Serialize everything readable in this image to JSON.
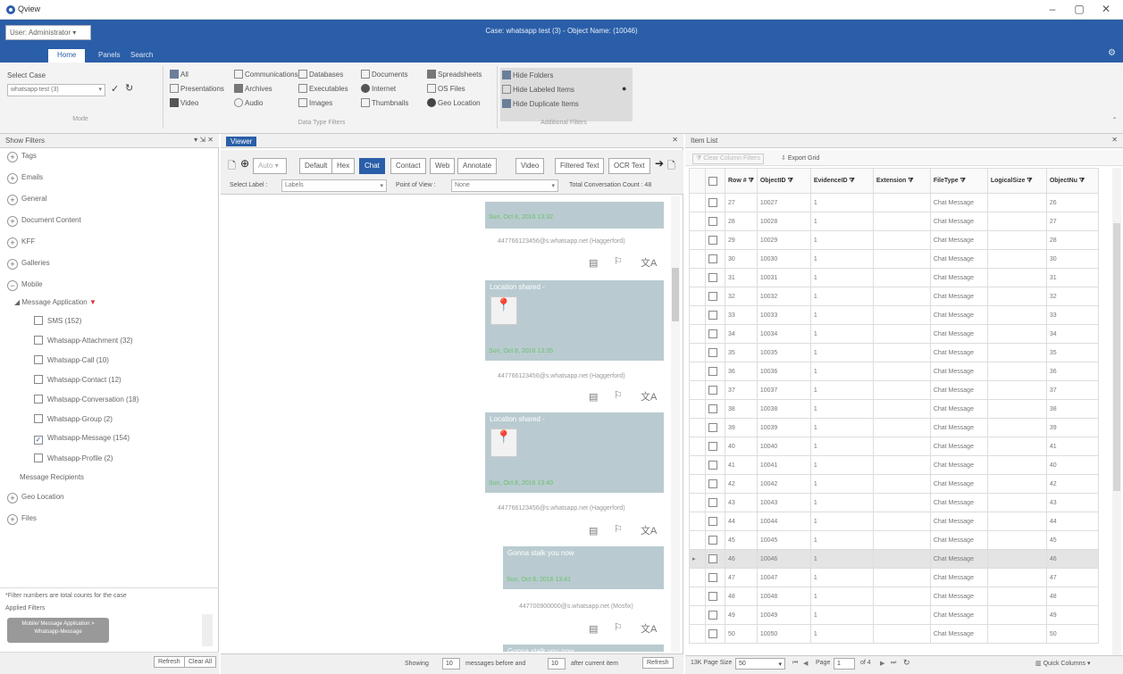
{
  "app": {
    "title": "Qview"
  },
  "window_controls": {
    "minimize": "–",
    "maximize": "▢",
    "close": "✕"
  },
  "header": {
    "user": "User: Administrator ▾",
    "case_title": "Case: whatsapp test (3) - Object Name: (10046)"
  },
  "ribbon_tabs": [
    {
      "label": "Home"
    },
    {
      "label": "Panels"
    },
    {
      "label": "Search"
    }
  ],
  "ribbon": {
    "select_case_label": "Select Case",
    "case_value": "whatsapp test (3)",
    "mode_group": "Mode",
    "data_types": {
      "all": "All",
      "presentations": "Presentations",
      "video": "Video",
      "communications": "Communications",
      "archives": "Archives",
      "audio": "Audio",
      "databases": "Databases",
      "executables": "Executables",
      "images": "Images",
      "documents": "Documents",
      "internet": "Internet",
      "thumbnails": "Thumbnails",
      "spreadsheets": "Spreadsheets",
      "os_files": "OS Files",
      "geo_location": "Geo Location",
      "group_name": "Data Type Filters"
    },
    "additional": {
      "hide_folders": "Hide Folders",
      "hide_labeled": "Hide Labeled Items",
      "hide_duplicate": "Hide Duplicate Items",
      "group_name": "Additional Filters"
    }
  },
  "left_panel": {
    "title": "Show Filters",
    "pin_icons": "▾ ⇲ ✕",
    "filters": [
      {
        "sym": "+",
        "label": "Tags"
      },
      {
        "sym": "+",
        "label": "Emails"
      },
      {
        "sym": "+",
        "label": "General"
      },
      {
        "sym": "+",
        "label": "Document Content"
      },
      {
        "sym": "+",
        "label": "KFF"
      },
      {
        "sym": "+",
        "label": "Galleries"
      },
      {
        "sym": "−",
        "label": "Mobile"
      }
    ],
    "message_app": "Message Application",
    "sub_items": [
      {
        "label": "SMS (152)",
        "checked": false
      },
      {
        "label": "Whatsapp-Attachment (32)",
        "checked": false
      },
      {
        "label": "Whatsapp-Call (10)",
        "checked": false
      },
      {
        "label": "Whatsapp-Contact (12)",
        "checked": false
      },
      {
        "label": "Whatsapp-Conversation (18)",
        "checked": false
      },
      {
        "label": "Whatsapp-Group (2)",
        "checked": false
      },
      {
        "label": "Whatsapp-Message (154)",
        "checked": true
      },
      {
        "label": "Whatsapp-Profile (2)",
        "checked": false
      }
    ],
    "message_recipients": "Message Recipients",
    "geo_location": "Geo Location",
    "files": "Files",
    "note": "*Filter numbers are total counts for the case",
    "applied_filters": "Applied Filters",
    "applied_chip_1": "Mobile/ Message Application >",
    "applied_chip_2": "Whatsapp-Message",
    "refresh": "Refresh",
    "clear_all": "Clear All"
  },
  "viewer": {
    "title": "Viewer",
    "buttons": [
      "Default",
      "Hex",
      "Chat",
      "Contact",
      "Web",
      "Annotate",
      "Video",
      "Filtered Text",
      "OCR Text"
    ],
    "zoom_value": "Auto",
    "select_label": "Select Label :",
    "labels_value": "Labels",
    "point_of_view": "Point of View :",
    "pov_value": "None",
    "total_count": "Total Conversation Count : 48",
    "messages": [
      {
        "title": "",
        "date": "Sun, Oct 8, 2016 13:32",
        "sender": "447766123456@s.whatsapp.net (Haggerford)"
      },
      {
        "title": "Location shared -",
        "date": "Sun, Oct 8, 2016 13:35",
        "sender": "447766123456@s.whatsapp.net (Haggerford)"
      },
      {
        "title": "Location shared -",
        "date": "Sun, Oct 8, 2016 13:40",
        "sender": "447766123456@s.whatsapp.net (Haggerford)"
      },
      {
        "title": "Gonna stalk you now",
        "date": "Sun, Oct 8, 2016 13:41",
        "sender": "447700900000@s.whatsapp.net (Mosfix)"
      },
      {
        "title": "Gonna stalk you now",
        "date": "",
        "sender": ""
      }
    ],
    "footer": {
      "showing": "Showing",
      "before_val": "10",
      "messages_before": "messages before and",
      "after_val": "10",
      "after_current": "after current item",
      "refresh": "Refresh"
    }
  },
  "item_list": {
    "title": "Item List",
    "clear_filters": "Clear Column Filters",
    "export": "Export Grid",
    "columns": [
      "Row #",
      "ObjectID",
      "EvidenceID",
      "Extension",
      "FileType",
      "LogicalSize",
      "ObjectNu"
    ],
    "rows": [
      [
        "27",
        "10027",
        "1",
        "",
        "Chat Message",
        "",
        "26"
      ],
      [
        "28",
        "10028",
        "1",
        "",
        "Chat Message",
        "",
        "27"
      ],
      [
        "29",
        "10029",
        "1",
        "",
        "Chat Message",
        "",
        "28"
      ],
      [
        "30",
        "10030",
        "1",
        "",
        "Chat Message",
        "",
        "30"
      ],
      [
        "31",
        "10031",
        "1",
        "",
        "Chat Message",
        "",
        "31"
      ],
      [
        "32",
        "10032",
        "1",
        "",
        "Chat Message",
        "",
        "32"
      ],
      [
        "33",
        "10033",
        "1",
        "",
        "Chat Message",
        "",
        "33"
      ],
      [
        "34",
        "10034",
        "1",
        "",
        "Chat Message",
        "",
        "34"
      ],
      [
        "35",
        "10035",
        "1",
        "",
        "Chat Message",
        "",
        "35"
      ],
      [
        "36",
        "10036",
        "1",
        "",
        "Chat Message",
        "",
        "36"
      ],
      [
        "37",
        "10037",
        "1",
        "",
        "Chat Message",
        "",
        "37"
      ],
      [
        "38",
        "10038",
        "1",
        "",
        "Chat Message",
        "",
        "38"
      ],
      [
        "39",
        "10039",
        "1",
        "",
        "Chat Message",
        "",
        "39"
      ],
      [
        "40",
        "10040",
        "1",
        "",
        "Chat Message",
        "",
        "41"
      ],
      [
        "41",
        "10041",
        "1",
        "",
        "Chat Message",
        "",
        "40"
      ],
      [
        "42",
        "10042",
        "1",
        "",
        "Chat Message",
        "",
        "42"
      ],
      [
        "43",
        "10043",
        "1",
        "",
        "Chat Message",
        "",
        "43"
      ],
      [
        "44",
        "10044",
        "1",
        "",
        "Chat Message",
        "",
        "44"
      ],
      [
        "45",
        "10045",
        "1",
        "",
        "Chat Message",
        "",
        "45"
      ],
      [
        "46",
        "10046",
        "1",
        "",
        "Chat Message",
        "",
        "46"
      ],
      [
        "47",
        "10047",
        "1",
        "",
        "Chat Message",
        "",
        "47"
      ],
      [
        "48",
        "10048",
        "1",
        "",
        "Chat Message",
        "",
        "48"
      ],
      [
        "49",
        "10049",
        "1",
        "",
        "Chat Message",
        "",
        "49"
      ],
      [
        "50",
        "10050",
        "1",
        "",
        "Chat Message",
        "",
        "50"
      ]
    ],
    "selected_row": 19,
    "footer": {
      "page_size_label": "13K Page Size",
      "page_size": "50",
      "page_label": "Page",
      "page": "1",
      "of_pages": "of 4",
      "quick_columns": "Quick Columns"
    }
  },
  "colors": {
    "accent": "#2a5ea8",
    "bubble": "#b9cbd0",
    "date_green": "#6cc06c"
  }
}
